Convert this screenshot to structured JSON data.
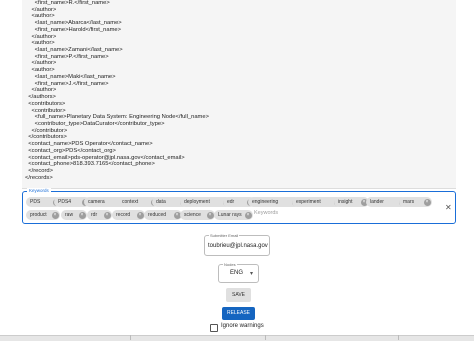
{
  "xml": {
    "lines": [
      "      <first_name>R.</first_name>",
      "    </author>",
      "    <author>",
      "      <last_name>Abarca</last_name>",
      "      <first_name>Harold</first_name>",
      "    </author>",
      "    <author>",
      "      <last_name>Zamani</last_name>",
      "      <first_name>P.</first_name>",
      "    </author>",
      "    <author>",
      "      <last_name>Maki</last_name>",
      "      <first_name>J.</first_name>",
      "    </author>",
      "  </authors>",
      "  <contributors>",
      "    <contributor>",
      "      <full_name>Planetary Data System: Engineering Node</full_name>",
      "      <contributor_type>DataCurator</contributor_type>",
      "    </contributor>",
      "  </contributors>",
      "  <contact_name>PDS Operator</contact_name>",
      "  <contact_org>PDS</contact_org>",
      "  <contact_email>pds-operator@jpl.nasa.gov</contact_email>",
      "  <contact_phone>818.393.7165</contact_phone>",
      "  </record>",
      "</records>"
    ]
  },
  "keywords": {
    "legend": "Keywords",
    "chips": [
      "PDS",
      "PDS4",
      "camera",
      "context",
      "data",
      "deployment",
      "edr",
      "engineering",
      "experiment",
      "insight",
      "lander",
      "mars",
      "product",
      "raw",
      "rdr",
      "record",
      "reduced",
      "science",
      "Lunar rays"
    ],
    "placeholder": "Keywords",
    "clear_glyph": "✕",
    "chip_delete_glyph": "×"
  },
  "submitter": {
    "legend": "Submitter Email",
    "value": "toubrieu@jpl.nasa.gov"
  },
  "nodes": {
    "legend": "Nodes",
    "value": "ENG",
    "caret": "▾"
  },
  "buttons": {
    "save": "SAVE",
    "release": "RELEASE"
  },
  "ignore_warnings": {
    "label": "Ignore warnings",
    "checked": false
  }
}
